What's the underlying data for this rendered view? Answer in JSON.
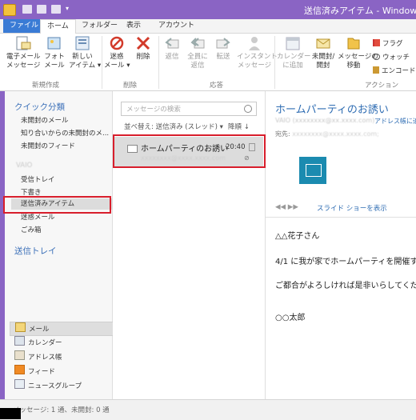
{
  "window": {
    "title": "送信済みアイテム - Window"
  },
  "tabs": [
    {
      "label": "ファイル"
    },
    {
      "label": "ホーム"
    },
    {
      "label": "フォルダー"
    },
    {
      "label": "表示"
    },
    {
      "label": "アカウント"
    }
  ],
  "ribbon": {
    "new": {
      "email_1": "電子メール",
      "email_2": "メッセージ",
      "photo_1": "フォト",
      "photo_2": "メール",
      "item_1": "新しい",
      "item_2": "アイテム ▾",
      "group": "新規作成"
    },
    "delete": {
      "junk_1": "迷惑",
      "junk_2": "メール ▾",
      "delete_1": "削除",
      "group": "削除"
    },
    "respond": {
      "reply": "返信",
      "replyall_1": "全員に",
      "replyall_2": "返信",
      "forward": "転送",
      "im_1": "インスタント",
      "im_2": "メッセージ",
      "group": "応答"
    },
    "actions": {
      "calendar_1": "カレンダー",
      "calendar_2": "に追加",
      "unread_1": "未開封/",
      "unread_2": "開封",
      "move_1": "メッセージの",
      "move_2": "移動",
      "flag": "フラグ",
      "watch": "ウォッチ",
      "encode": "エンコード",
      "group": "アクション"
    }
  },
  "nav": {
    "quick_views": "クイック分類",
    "items_quick": [
      {
        "label": "未開封のメール"
      },
      {
        "label": "知り合いからの未開封のメ..."
      },
      {
        "label": "未開封のフィード"
      }
    ],
    "account_label": "VAIO",
    "items_folders": [
      {
        "label": "受信トレイ"
      },
      {
        "label": "下書き"
      },
      {
        "label": "送信済みアイテム"
      },
      {
        "label": "迷惑メール"
      },
      {
        "label": "ごみ箱"
      }
    ],
    "outbox": "送信トレイ",
    "bottom": [
      {
        "label": "メール"
      },
      {
        "label": "カレンダー"
      },
      {
        "label": "アドレス帳"
      },
      {
        "label": "フィード"
      },
      {
        "label": "ニュースグループ"
      }
    ]
  },
  "message_list": {
    "search_placeholder": "メッセージの検索",
    "sort_by": "並べ替え: 送信済み (スレッド) ▾",
    "sort_order": "降順 ↓",
    "items": [
      {
        "subject": "ホームパーティのお誘い",
        "time": "20:40",
        "from": "xxxxxxxx@xxxx.xxxx.com"
      }
    ]
  },
  "reading": {
    "subject": "ホームパーティのお誘い",
    "from_blurred": "VAIO (xxxxxxxx@xx.xxxx.com)",
    "address_link": "アドレス帳に追",
    "to_label": "宛先:",
    "to_blurred": "xxxxxxxx@xxxx.xxxx.com;",
    "slide_nav": "◀◀   ▶▶",
    "slide_link": "スライド ショーを表示",
    "body": [
      "△△花子さん",
      "4/1 に我が家でホームパーティを開催す",
      "ご都合がよろしければ是非いらしてくだ",
      "○○太郎"
    ]
  },
  "status": {
    "text": "メッセージ: 1 通、未開封: 0 通"
  },
  "colors": {
    "accent": "#8a64c4",
    "file_tab": "#3a7bd5",
    "link": "#2f6db3",
    "highlight": "#d81e2c"
  }
}
